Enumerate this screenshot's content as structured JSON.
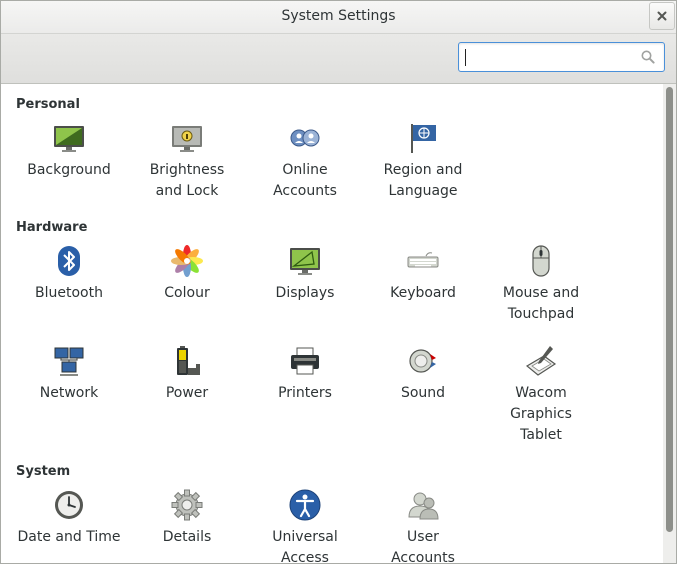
{
  "window": {
    "title": "System Settings"
  },
  "search": {
    "value": "",
    "placeholder": ""
  },
  "sections": [
    {
      "title": "Personal"
    },
    {
      "title": "Hardware"
    },
    {
      "title": "System"
    }
  ],
  "items": {
    "background": {
      "label": "Background",
      "icon": "background-icon"
    },
    "brightness": {
      "label": "Brightness\nand Lock",
      "icon": "brightness-lock-icon"
    },
    "online_accounts": {
      "label": "Online\nAccounts",
      "icon": "online-accounts-icon"
    },
    "region": {
      "label": "Region and\nLanguage",
      "icon": "region-flag-icon"
    },
    "bluetooth": {
      "label": "Bluetooth",
      "icon": "bluetooth-icon"
    },
    "colour": {
      "label": "Colour",
      "icon": "colour-icon"
    },
    "displays": {
      "label": "Displays",
      "icon": "displays-icon"
    },
    "keyboard": {
      "label": "Keyboard",
      "icon": "keyboard-icon"
    },
    "mouse": {
      "label": "Mouse and\nTouchpad",
      "icon": "mouse-icon"
    },
    "network": {
      "label": "Network",
      "icon": "network-icon"
    },
    "power": {
      "label": "Power",
      "icon": "power-icon"
    },
    "printers": {
      "label": "Printers",
      "icon": "printer-icon"
    },
    "sound": {
      "label": "Sound",
      "icon": "sound-icon"
    },
    "wacom": {
      "label": "Wacom\nGraphics\nTablet",
      "icon": "wacom-tablet-icon"
    },
    "datetime": {
      "label": "Date and Time",
      "icon": "clock-icon"
    },
    "details": {
      "label": "Details",
      "icon": "gear-icon"
    },
    "universal_access": {
      "label": "Universal\nAccess",
      "icon": "universal-access-icon"
    },
    "user_accounts": {
      "label": "User\nAccounts",
      "icon": "user-accounts-icon"
    }
  },
  "colors": {
    "accent": "#4a90d9",
    "text": "#2e3436",
    "toolbar": "#e4e4e2"
  }
}
